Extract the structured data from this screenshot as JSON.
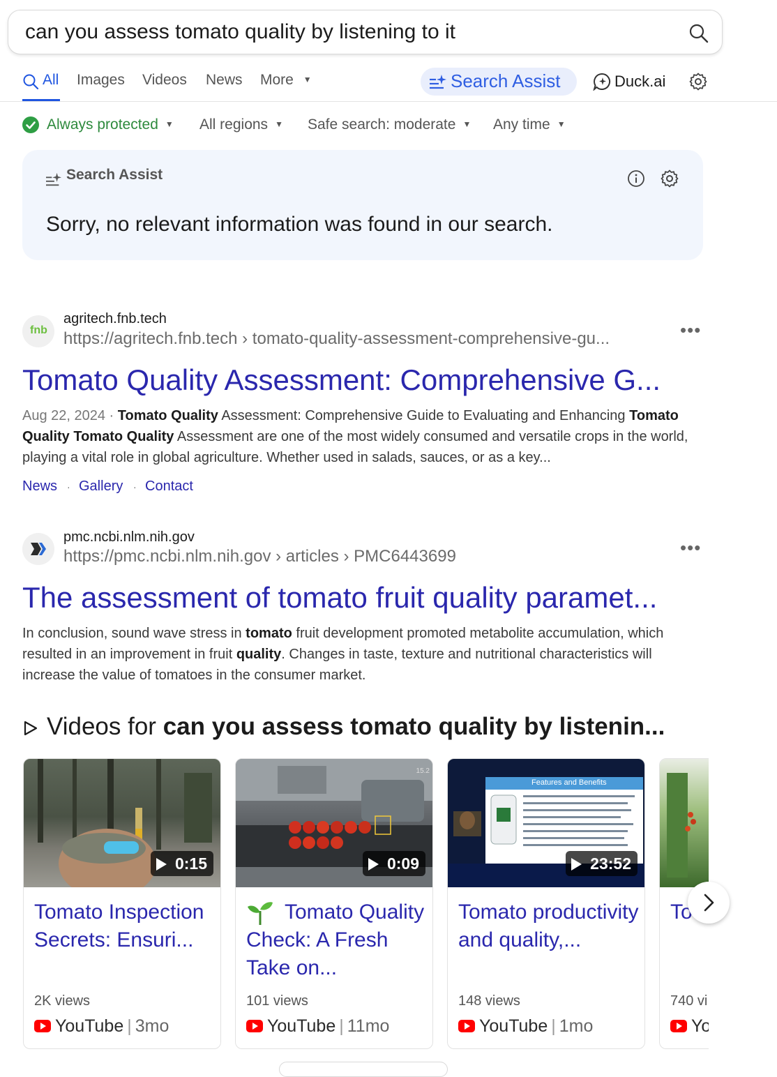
{
  "search": {
    "query": "can you assess tomato quality by listening to it"
  },
  "nav": {
    "tabs": [
      {
        "label": "All"
      },
      {
        "label": "Images"
      },
      {
        "label": "Videos"
      },
      {
        "label": "News"
      },
      {
        "label": "More"
      }
    ],
    "search_assist": "Search Assist",
    "duck_ai": "Duck.ai"
  },
  "filters": {
    "protected": "Always protected",
    "regions": "All regions",
    "safe_search": "Safe search: moderate",
    "time": "Any time"
  },
  "assist_box": {
    "title": "Search Assist",
    "message": "Sorry, no relevant information was found in our search."
  },
  "results": [
    {
      "domain": "agritech.fnb.tech",
      "favicon_text": "fnb",
      "url": "https://agritech.fnb.tech › tomato-quality-assessment-comprehensive-gu...",
      "title": "Tomato Quality Assessment: Comprehensive G...",
      "date": "Aug 22, 2024",
      "snippet_parts": [
        "Tomato Quality",
        " Assessment: Comprehensive Guide to Evaluating and Enhancing ",
        "Tomato Quality Tomato Quality",
        " Assessment are one of the most widely consumed and versatile crops in the world, playing a vital role in global agriculture. Whether used in salads, sauces, or as a key..."
      ],
      "sitelinks": [
        "News",
        "Gallery",
        "Contact"
      ]
    },
    {
      "domain": "pmc.ncbi.nlm.nih.gov",
      "url": "https://pmc.ncbi.nlm.nih.gov › articles › PMC6443699",
      "title": "The assessment of tomato fruit quality paramet...",
      "snippet_parts": [
        "In conclusion, sound wave stress in ",
        "tomato",
        " fruit development promoted metabolite accumulation, which resulted in an improvement in fruit ",
        "quality",
        ". Changes in taste, texture and nutritional characteristics will increase the value of tomatoes in the consumer market."
      ]
    }
  ],
  "videos": {
    "heading_prefix": "Videos for ",
    "heading_query": "can you assess tomato quality by listenin...",
    "items": [
      {
        "title": "Tomato Inspection Secrets: Ensuri...",
        "duration": "0:15",
        "views": "2K views",
        "source": "YouTube",
        "age": "3mo"
      },
      {
        "title": "Tomato Quality Check: A Fresh Take on...",
        "duration": "0:09",
        "views": "101 views",
        "source": "YouTube",
        "age": "11mo",
        "thumb_text": "15.2"
      },
      {
        "title": "Tomato productivity and quality,...",
        "duration": "23:52",
        "views": "148 views",
        "source": "YouTube",
        "age": "1mo",
        "thumb_text": "Features and Benefits"
      },
      {
        "title": "To Tecl Boo",
        "views": "740 vi",
        "source": "Yo"
      }
    ]
  }
}
